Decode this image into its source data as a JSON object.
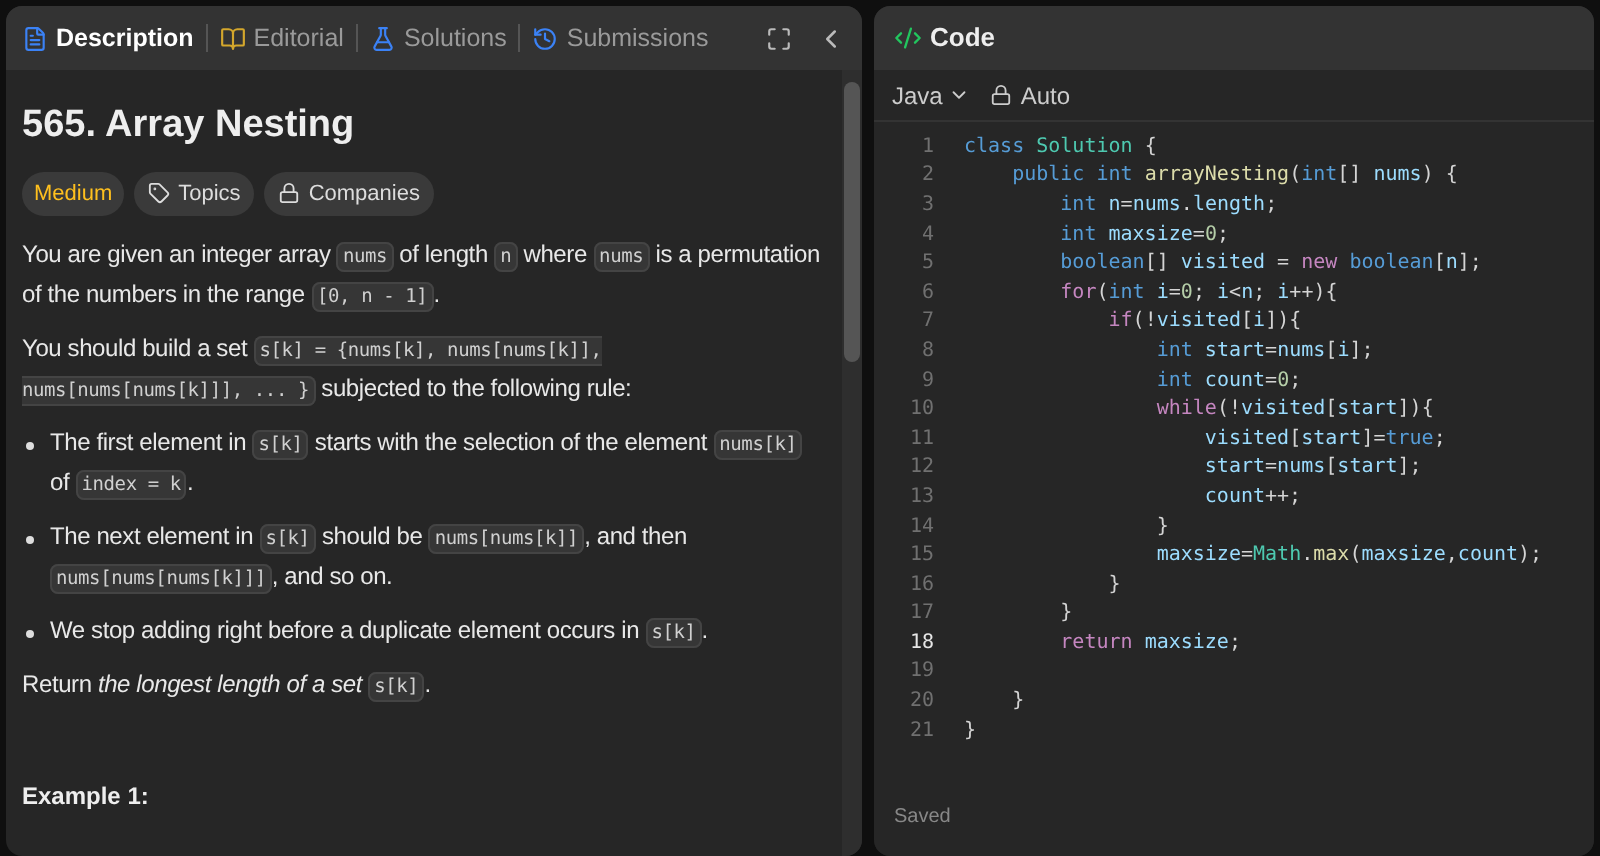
{
  "tabs": [
    {
      "label": "Description",
      "selected": true
    },
    {
      "label": "Editorial",
      "selected": false
    },
    {
      "label": "Solutions",
      "selected": false
    },
    {
      "label": "Submissions",
      "selected": false
    }
  ],
  "problem": {
    "title": "565. Array Nesting",
    "difficulty": "Medium",
    "tags": [
      {
        "label": "Topics"
      },
      {
        "label": "Companies"
      }
    ],
    "blocks": [
      {
        "kind": "para",
        "segments": [
          {
            "kind": "text",
            "text": "You are given an integer array "
          },
          {
            "kind": "code",
            "text": "nums"
          },
          {
            "kind": "text",
            "text": " of length "
          },
          {
            "kind": "code",
            "text": "n"
          },
          {
            "kind": "text",
            "text": " where "
          },
          {
            "kind": "code",
            "text": "nums"
          },
          {
            "kind": "text",
            "text": " is a permutation of the numbers in the range "
          },
          {
            "kind": "code",
            "text": "[0, n - 1]"
          },
          {
            "kind": "text",
            "text": "."
          }
        ]
      },
      {
        "kind": "para",
        "segments": [
          {
            "kind": "text",
            "text": "You should build a set "
          },
          {
            "kind": "code",
            "text": "s[k] = {nums[k], nums[nums[k]], nums[nums[nums[k]]], ... }"
          },
          {
            "kind": "text",
            "text": " subjected to the following rule:"
          }
        ]
      },
      {
        "kind": "bullet",
        "segments": [
          {
            "kind": "text",
            "text": "The first element in "
          },
          {
            "kind": "code",
            "text": "s[k]"
          },
          {
            "kind": "text",
            "text": " starts with the selection of the element "
          },
          {
            "kind": "code",
            "text": "nums[k]"
          },
          {
            "kind": "text",
            "text": " of "
          },
          {
            "kind": "code",
            "text": "index = k"
          },
          {
            "kind": "text",
            "text": "."
          }
        ]
      },
      {
        "kind": "bullet",
        "segments": [
          {
            "kind": "text",
            "text": "The next element in "
          },
          {
            "kind": "code",
            "text": "s[k]"
          },
          {
            "kind": "text",
            "text": " should be "
          },
          {
            "kind": "code",
            "text": "nums[nums[k]]"
          },
          {
            "kind": "text",
            "text": ", and then "
          },
          {
            "kind": "code",
            "text": "nums[nums[nums[k]]]"
          },
          {
            "kind": "text",
            "text": ", and so on."
          }
        ]
      },
      {
        "kind": "bullet",
        "segments": [
          {
            "kind": "text",
            "text": "We stop adding right before a duplicate element occurs in "
          },
          {
            "kind": "code",
            "text": "s[k]"
          },
          {
            "kind": "text",
            "text": "."
          }
        ]
      },
      {
        "kind": "para",
        "segments": [
          {
            "kind": "text",
            "text": "Return "
          },
          {
            "kind": "italic",
            "text": "the longest length of a set "
          },
          {
            "kind": "code",
            "text": "s[k]"
          },
          {
            "kind": "text",
            "text": "."
          }
        ]
      }
    ],
    "example_heading": "Example 1:"
  },
  "editor": {
    "title": "Code",
    "language": "Java",
    "mode": "Auto",
    "status": "Saved",
    "lines": [
      {
        "number": "1",
        "selected": false,
        "tokens": [
          {
            "kind": "kw",
            "text": "class "
          },
          {
            "kind": "type",
            "text": "Solution"
          },
          {
            "kind": "p",
            "text": " {"
          }
        ]
      },
      {
        "number": "2",
        "selected": false,
        "tokens": [
          {
            "kind": "kw",
            "text": "    public int "
          },
          {
            "kind": "fn",
            "text": "arrayNesting"
          },
          {
            "kind": "p",
            "text": "("
          },
          {
            "kind": "kw",
            "text": "int"
          },
          {
            "kind": "p",
            "text": "[] "
          },
          {
            "kind": "id",
            "text": "nums"
          },
          {
            "kind": "p",
            "text": ") {"
          }
        ]
      },
      {
        "number": "3",
        "selected": false,
        "tokens": [
          {
            "kind": "kw",
            "text": "        int "
          },
          {
            "kind": "id",
            "text": "n"
          },
          {
            "kind": "p",
            "text": "="
          },
          {
            "kind": "id",
            "text": "nums"
          },
          {
            "kind": "p",
            "text": "."
          },
          {
            "kind": "id",
            "text": "length"
          },
          {
            "kind": "p",
            "text": ";"
          }
        ]
      },
      {
        "number": "4",
        "selected": false,
        "tokens": [
          {
            "kind": "kw",
            "text": "        int "
          },
          {
            "kind": "id",
            "text": "maxsize"
          },
          {
            "kind": "p",
            "text": "="
          },
          {
            "kind": "num",
            "text": "0"
          },
          {
            "kind": "p",
            "text": ";"
          }
        ]
      },
      {
        "number": "5",
        "selected": false,
        "tokens": [
          {
            "kind": "kw",
            "text": "        boolean"
          },
          {
            "kind": "p",
            "text": "[] "
          },
          {
            "kind": "id",
            "text": "visited"
          },
          {
            "kind": "p",
            "text": " = "
          },
          {
            "kind": "ctrl",
            "text": "new "
          },
          {
            "kind": "kw",
            "text": "boolean"
          },
          {
            "kind": "p",
            "text": "["
          },
          {
            "kind": "id",
            "text": "n"
          },
          {
            "kind": "p",
            "text": "];"
          }
        ]
      },
      {
        "number": "6",
        "selected": false,
        "tokens": [
          {
            "kind": "ctrl",
            "text": "        for"
          },
          {
            "kind": "p",
            "text": "("
          },
          {
            "kind": "kw",
            "text": "int "
          },
          {
            "kind": "id",
            "text": "i"
          },
          {
            "kind": "p",
            "text": "="
          },
          {
            "kind": "num",
            "text": "0"
          },
          {
            "kind": "p",
            "text": "; "
          },
          {
            "kind": "id",
            "text": "i"
          },
          {
            "kind": "p",
            "text": "<"
          },
          {
            "kind": "id",
            "text": "n"
          },
          {
            "kind": "p",
            "text": "; "
          },
          {
            "kind": "id",
            "text": "i"
          },
          {
            "kind": "p",
            "text": "++){"
          }
        ]
      },
      {
        "number": "7",
        "selected": false,
        "tokens": [
          {
            "kind": "ctrl",
            "text": "            if"
          },
          {
            "kind": "p",
            "text": "(!"
          },
          {
            "kind": "id",
            "text": "visited"
          },
          {
            "kind": "p",
            "text": "["
          },
          {
            "kind": "id",
            "text": "i"
          },
          {
            "kind": "p",
            "text": "]){"
          }
        ]
      },
      {
        "number": "8",
        "selected": false,
        "tokens": [
          {
            "kind": "kw",
            "text": "                int "
          },
          {
            "kind": "id",
            "text": "start"
          },
          {
            "kind": "p",
            "text": "="
          },
          {
            "kind": "id",
            "text": "nums"
          },
          {
            "kind": "p",
            "text": "["
          },
          {
            "kind": "id",
            "text": "i"
          },
          {
            "kind": "p",
            "text": "];"
          }
        ]
      },
      {
        "number": "9",
        "selected": false,
        "tokens": [
          {
            "kind": "kw",
            "text": "                int "
          },
          {
            "kind": "id",
            "text": "count"
          },
          {
            "kind": "p",
            "text": "="
          },
          {
            "kind": "num",
            "text": "0"
          },
          {
            "kind": "p",
            "text": ";"
          }
        ]
      },
      {
        "number": "10",
        "selected": false,
        "tokens": [
          {
            "kind": "ctrl",
            "text": "                while"
          },
          {
            "kind": "p",
            "text": "(!"
          },
          {
            "kind": "id",
            "text": "visited"
          },
          {
            "kind": "p",
            "text": "["
          },
          {
            "kind": "id",
            "text": "start"
          },
          {
            "kind": "p",
            "text": "]){"
          }
        ]
      },
      {
        "number": "11",
        "selected": false,
        "tokens": [
          {
            "kind": "id",
            "text": "                    visited"
          },
          {
            "kind": "p",
            "text": "["
          },
          {
            "kind": "id",
            "text": "start"
          },
          {
            "kind": "p",
            "text": "]="
          },
          {
            "kind": "kw",
            "text": "true"
          },
          {
            "kind": "p",
            "text": ";"
          }
        ]
      },
      {
        "number": "12",
        "selected": false,
        "tokens": [
          {
            "kind": "id",
            "text": "                    start"
          },
          {
            "kind": "p",
            "text": "="
          },
          {
            "kind": "id",
            "text": "nums"
          },
          {
            "kind": "p",
            "text": "["
          },
          {
            "kind": "id",
            "text": "start"
          },
          {
            "kind": "p",
            "text": "];"
          }
        ]
      },
      {
        "number": "13",
        "selected": false,
        "tokens": [
          {
            "kind": "id",
            "text": "                    count"
          },
          {
            "kind": "p",
            "text": "++;"
          }
        ]
      },
      {
        "number": "14",
        "selected": false,
        "tokens": [
          {
            "kind": "p",
            "text": "                }"
          }
        ]
      },
      {
        "number": "15",
        "selected": false,
        "tokens": [
          {
            "kind": "id",
            "text": "                maxsize"
          },
          {
            "kind": "p",
            "text": "="
          },
          {
            "kind": "type",
            "text": "Math"
          },
          {
            "kind": "p",
            "text": "."
          },
          {
            "kind": "fn",
            "text": "max"
          },
          {
            "kind": "p",
            "text": "("
          },
          {
            "kind": "id",
            "text": "maxsize"
          },
          {
            "kind": "p",
            "text": ","
          },
          {
            "kind": "id",
            "text": "count"
          },
          {
            "kind": "p",
            "text": ");"
          }
        ]
      },
      {
        "number": "16",
        "selected": false,
        "tokens": [
          {
            "kind": "p",
            "text": "            }"
          }
        ]
      },
      {
        "number": "17",
        "selected": false,
        "tokens": [
          {
            "kind": "p",
            "text": "        }"
          }
        ]
      },
      {
        "number": "18",
        "selected": true,
        "tokens": [
          {
            "kind": "ctrl",
            "text": "        return "
          },
          {
            "kind": "id",
            "text": "maxsize"
          },
          {
            "kind": "p",
            "text": ";"
          }
        ]
      },
      {
        "number": "19",
        "selected": false
      },
      {
        "number": "20",
        "selected": false,
        "tokens": [
          {
            "kind": "p",
            "text": "    }"
          }
        ]
      },
      {
        "number": "21",
        "selected": false,
        "tokens": [
          {
            "kind": "p",
            "text": "}"
          }
        ]
      }
    ]
  }
}
